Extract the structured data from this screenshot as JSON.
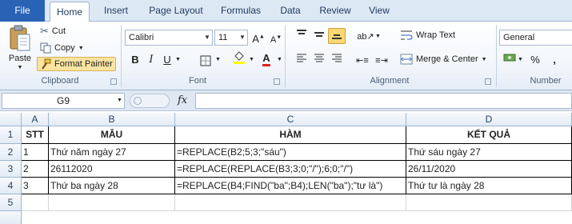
{
  "tabs": [
    "File",
    "Home",
    "Insert",
    "Page Layout",
    "Formulas",
    "Data",
    "Review",
    "View"
  ],
  "clipboard": {
    "paste": "Paste",
    "cut": "Cut",
    "copy": "Copy",
    "format_painter": "Format Painter",
    "group": "Clipboard"
  },
  "font": {
    "name": "Calibri",
    "size": "11",
    "bold": "B",
    "italic": "I",
    "underline": "U",
    "font_color_glyph": "A",
    "group": "Font"
  },
  "alignment": {
    "wrap_text": "Wrap Text",
    "merge_center": "Merge & Center",
    "group": "Alignment"
  },
  "number": {
    "format": "General",
    "percent": "%",
    "comma": ",",
    "group": "Number"
  },
  "formula_bar": {
    "name_box": "G9",
    "fx": "fx",
    "content": ""
  },
  "sheet": {
    "columns": [
      "A",
      "B",
      "C",
      "D"
    ],
    "rows": [
      "1",
      "2",
      "3",
      "4",
      "5"
    ],
    "header": [
      "STT",
      "MẪU",
      "HÀM",
      "KẾT QUẢ"
    ],
    "data": [
      [
        "1",
        "Thứ năm ngày 27",
        "=REPLACE(B2;5;3;\"sáu\")",
        "Thứ sáu ngày 27"
      ],
      [
        "2",
        "26112020",
        "=REPLACE(REPLACE(B3;3;0;\"/\");6;0;\"/\")",
        "26/11/2020"
      ],
      [
        "3",
        "Thứ ba ngày 28",
        "=REPLACE(B4;FIND(\"ba\";B4);LEN(\"ba\");\"tư là\")",
        "Thứ tư là ngày 28"
      ]
    ]
  },
  "colors": {
    "file_tab": "#2a62b6",
    "ribbon_bg": "#f1f5fb",
    "header_bg": "#e3ebf5",
    "font_color_bar": "#e02020",
    "highlight_bar": "#ffff00"
  }
}
